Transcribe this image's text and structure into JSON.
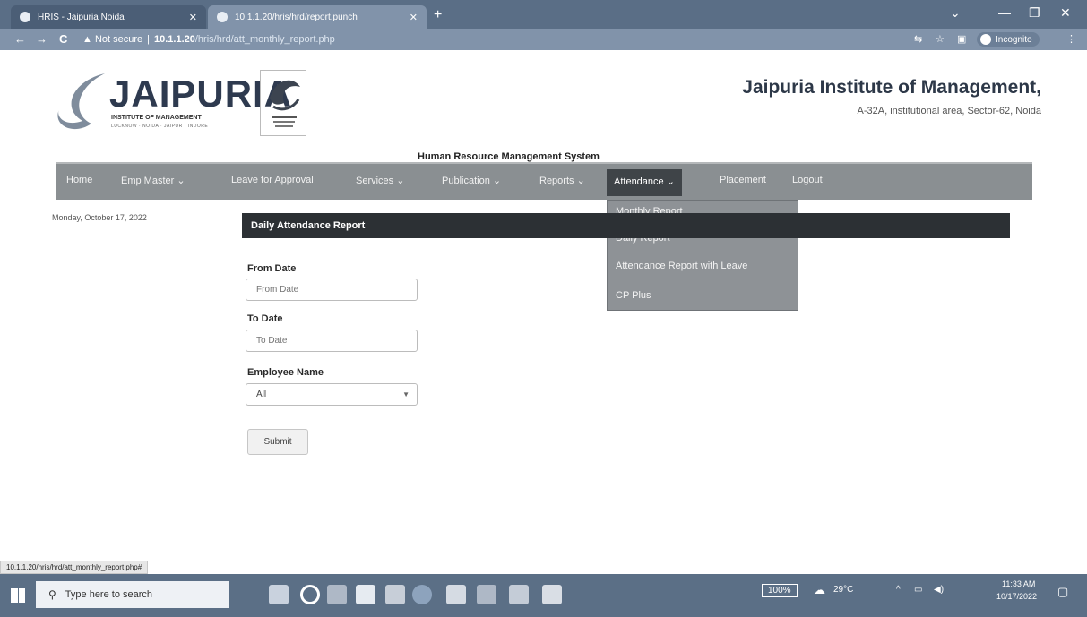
{
  "browser": {
    "tabs": [
      {
        "title": "HRIS - Jaipuria Noida"
      },
      {
        "title": "10.1.1.20/hris/hrd/report.punch"
      }
    ],
    "new_tab": "+",
    "tab_close": "✕",
    "window_controls": {
      "chevron": "⌄",
      "minimize": "—",
      "restore": "❐",
      "close": "✕"
    },
    "nav": {
      "back": "←",
      "forward": "→",
      "reload": "C"
    },
    "address": {
      "warning": "▲ Not secure",
      "separator": "|",
      "host": "10.1.1.20",
      "path": "/hris/hrd/att_monthly_report.php"
    },
    "incognito_label": "Incognito",
    "menu": "⋮",
    "status_url": "10.1.1.20/hris/hrd/att_monthly_report.php#"
  },
  "header": {
    "logo_text": "JAIPURIA",
    "logo_subtitle": "INSTITUTE OF MANAGEMENT",
    "logo_campuses": "LUCKNOW · NOIDA · JAIPUR · INDORE",
    "institute_name": "Jaipuria Institute of Management,",
    "institute_address": "A-32A, institutional area, Sector-62, Noida",
    "system_title": "Human Resource Management System"
  },
  "nav": {
    "items": [
      {
        "label": "Home"
      },
      {
        "label": "Emp Master ⌄"
      },
      {
        "label": "Leave for Approval"
      },
      {
        "label": "Services ⌄"
      },
      {
        "label": "Publication ⌄"
      },
      {
        "label": "Reports ⌄"
      },
      {
        "label": "Attendance ⌄"
      },
      {
        "label": "Placement"
      },
      {
        "label": "Logout"
      }
    ],
    "attendance_menu": [
      {
        "label": "Monthly Report"
      },
      {
        "label": "Daily Report"
      },
      {
        "label": "Attendance Report with Leave"
      },
      {
        "label": "CP Plus"
      }
    ]
  },
  "sidebar": {
    "date": "Monday, October 17, 2022"
  },
  "report": {
    "title": "Daily Attendance Report",
    "from_label": "From Date",
    "from_placeholder": "From Date",
    "to_label": "To Date",
    "to_placeholder": "To Date",
    "employee_label": "Employee Name",
    "employee_selected": "All",
    "submit_label": "Submit"
  },
  "taskbar": {
    "search_placeholder": "Type here to search",
    "battery_label": "100%",
    "temperature": "29°C",
    "time": "11:33 AM",
    "date": "10/17/2022"
  }
}
